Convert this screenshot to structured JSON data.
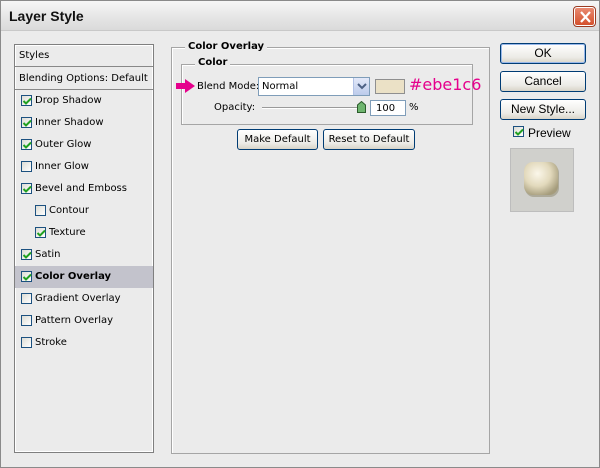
{
  "window": {
    "title": "Layer Style"
  },
  "styles_list": [
    {
      "label": "Styles",
      "kind": "header",
      "checked": null
    },
    {
      "label": "Blending Options: Default",
      "kind": "header",
      "checked": null
    },
    {
      "label": "Drop Shadow",
      "kind": "item",
      "checked": true
    },
    {
      "label": "Inner Shadow",
      "kind": "item",
      "checked": true
    },
    {
      "label": "Outer Glow",
      "kind": "item",
      "checked": true
    },
    {
      "label": "Inner Glow",
      "kind": "item",
      "checked": false
    },
    {
      "label": "Bevel and Emboss",
      "kind": "item",
      "checked": true
    },
    {
      "label": "Contour",
      "kind": "sub",
      "checked": false
    },
    {
      "label": "Texture",
      "kind": "sub",
      "checked": true
    },
    {
      "label": "Satin",
      "kind": "item",
      "checked": true
    },
    {
      "label": "Color Overlay",
      "kind": "item",
      "checked": true,
      "selected": true
    },
    {
      "label": "Gradient Overlay",
      "kind": "item",
      "checked": false
    },
    {
      "label": "Pattern Overlay",
      "kind": "item",
      "checked": false
    },
    {
      "label": "Stroke",
      "kind": "item",
      "checked": false
    }
  ],
  "panel": {
    "title": "Color Overlay",
    "group_title": "Color",
    "blend_mode_label": "Blend Mode:",
    "blend_mode_value": "Normal",
    "overlay_color": "#ebe1c6",
    "color_annotation": "#ebe1c6",
    "opacity_label": "Opacity:",
    "opacity_value": "100",
    "opacity_unit": "%",
    "make_default": "Make Default",
    "reset_default": "Reset to Default"
  },
  "actions": {
    "ok": "OK",
    "cancel": "Cancel",
    "new_style": "New Style...",
    "preview_label": "Preview",
    "preview_checked": true
  },
  "colors": {
    "annotation": "#e5008c",
    "selected_row": "#c3c3cc",
    "close": "#d4502c"
  }
}
